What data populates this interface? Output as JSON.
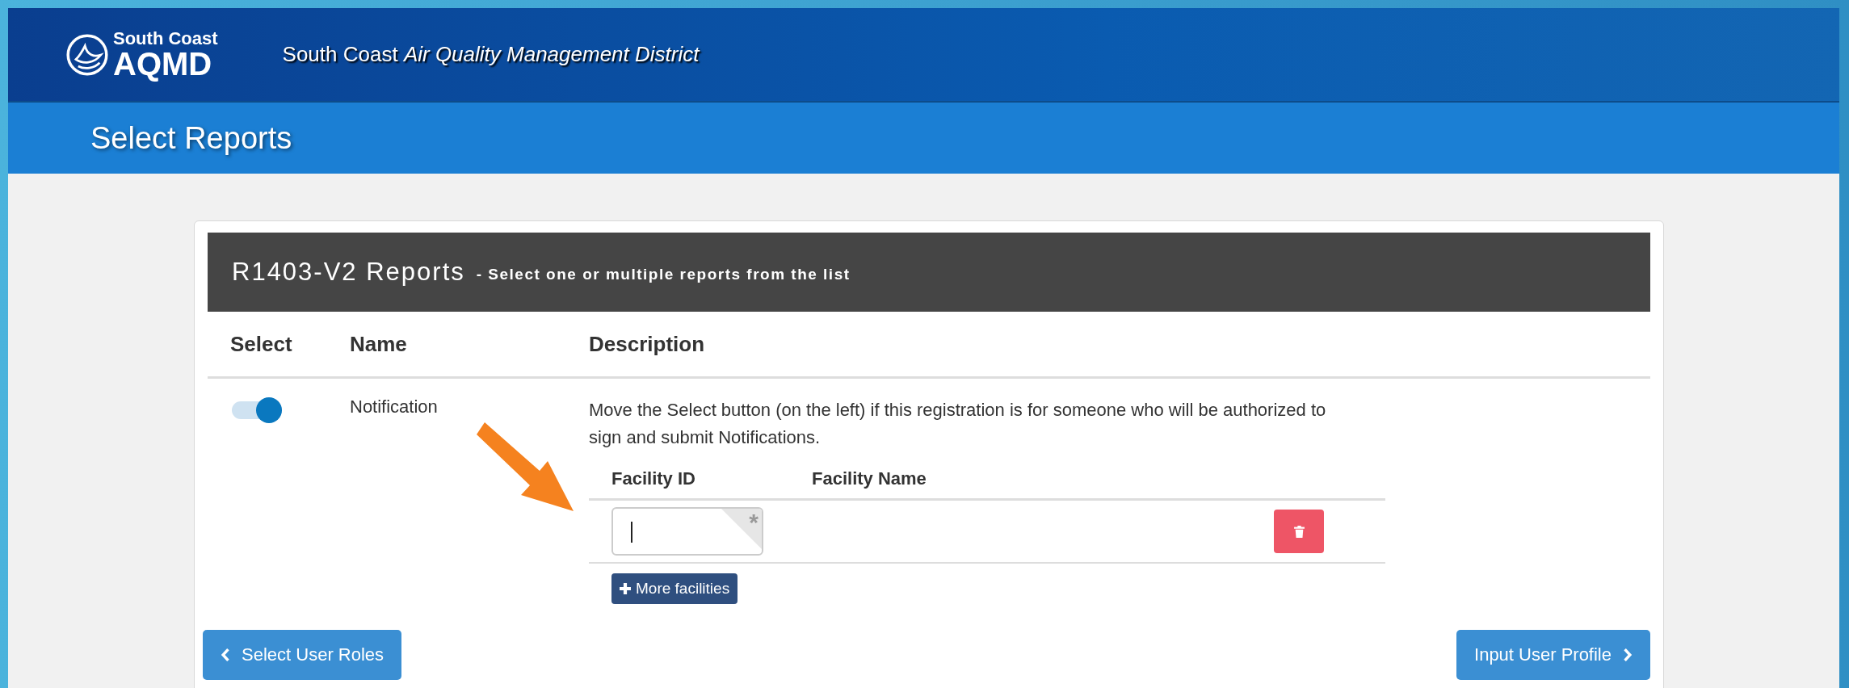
{
  "header": {
    "logo_top": "South Coast",
    "logo_bottom": "AQMD",
    "title": "South Coast *Air Quality Management District*"
  },
  "banner": {
    "title": "Select Reports"
  },
  "panel": {
    "title": "R1403-V2 Reports",
    "subtitle": "- Select one or multiple reports from the list"
  },
  "columns": [
    "Select",
    "Name",
    "Description"
  ],
  "reports": [
    {
      "selected": true,
      "name": "Notification",
      "description": "Move the Select button (on the left) if this registration is for someone who will be authorized to sign and submit Notifications.",
      "facility_columns": [
        "Facility ID",
        "Facility Name"
      ],
      "facilities": [
        {
          "required_mark": "*"
        }
      ],
      "add_button": "More facilities"
    }
  ],
  "nav": {
    "back": "Select User Roles",
    "next": "Input User Profile"
  }
}
